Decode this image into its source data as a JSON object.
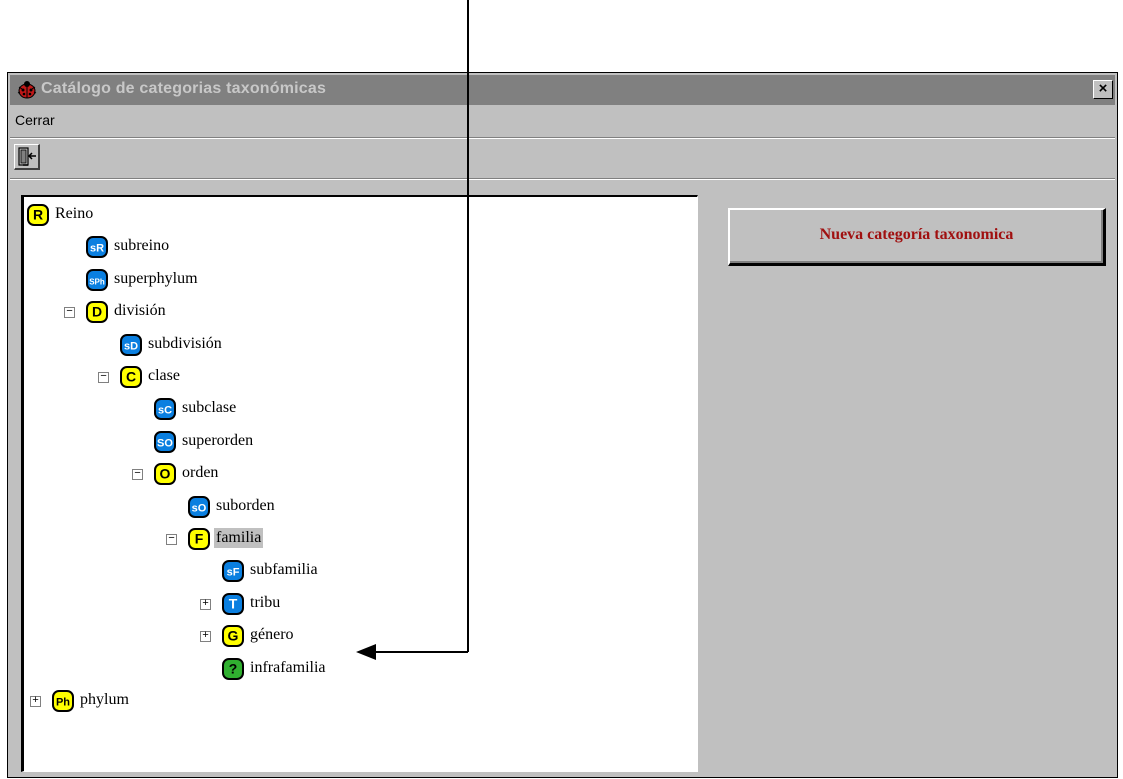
{
  "window": {
    "title": "Catálogo de categorias taxonómicas",
    "close_label": "×"
  },
  "menu": {
    "items": [
      {
        "label": "Cerrar"
      }
    ]
  },
  "toolbar": {
    "exit_icon": "exit-door-icon"
  },
  "tree": {
    "nodes": [
      {
        "label": "Reino",
        "badge": "R",
        "icon_style": "yellow"
      },
      {
        "label": "subreino",
        "badge": "sR",
        "icon_style": "blue"
      },
      {
        "label": "superphylum",
        "badge": "SPh",
        "icon_style": "blue"
      },
      {
        "label": "división",
        "badge": "D",
        "icon_style": "yellow",
        "toggle": "−"
      },
      {
        "label": "subdivisión",
        "badge": "sD",
        "icon_style": "blue"
      },
      {
        "label": "clase",
        "badge": "C",
        "icon_style": "yellow",
        "toggle": "−"
      },
      {
        "label": "subclase",
        "badge": "sC",
        "icon_style": "blue"
      },
      {
        "label": "superorden",
        "badge": "SO",
        "icon_style": "blue"
      },
      {
        "label": "orden",
        "badge": "O",
        "icon_style": "yellow",
        "toggle": "−"
      },
      {
        "label": "suborden",
        "badge": "sO",
        "icon_style": "blue"
      },
      {
        "label": "familia",
        "badge": "F",
        "icon_style": "yellow",
        "toggle": "−",
        "selected": true
      },
      {
        "label": "subfamilia",
        "badge": "sF",
        "icon_style": "blue"
      },
      {
        "label": "tribu",
        "badge": "T",
        "icon_style": "blue",
        "toggle": "+"
      },
      {
        "label": "género",
        "badge": "G",
        "icon_style": "yellow",
        "toggle": "+"
      },
      {
        "label": "infrafamilia",
        "badge": "?",
        "icon_style": "green"
      },
      {
        "label": "phylum",
        "badge": "Ph",
        "icon_style": "yellow",
        "toggle": "+"
      }
    ]
  },
  "actions": {
    "new_category_label": "Nueva categoría taxonomica"
  },
  "colors": {
    "badge_yellow": "#ffff00",
    "badge_blue": "#0a7fe0",
    "badge_green": "#30b030",
    "button_text": "#a01010",
    "titlebar": "#808080"
  }
}
